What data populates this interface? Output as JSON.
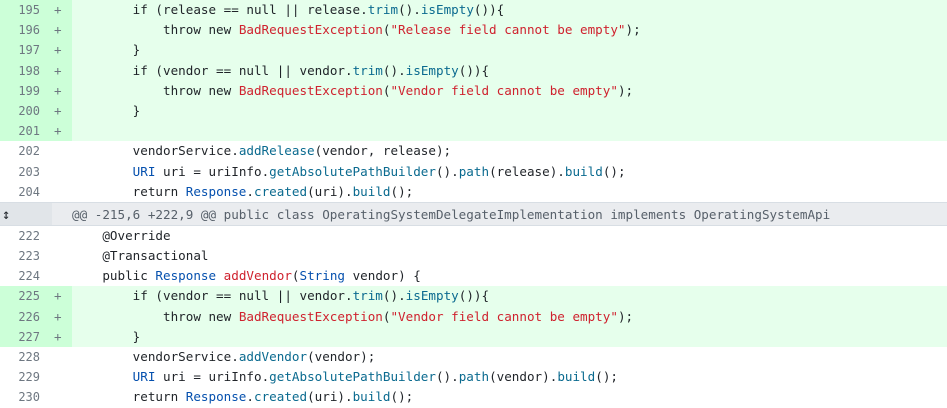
{
  "diff": {
    "marker_added": "+",
    "hunk_header": "@@ -215,6 +222,9 @@ public class OperatingSystemDelegateImplementation implements OperatingSystemApi",
    "expand_icon": "↕",
    "rows_top": [
      {
        "num": "195",
        "type": "add",
        "tokens": [
          {
            "t": "        if (release == "
          },
          {
            "t": "null",
            "c": "kw"
          },
          {
            "t": " || release."
          },
          {
            "t": "trim",
            "c": "fn"
          },
          {
            "t": "()."
          },
          {
            "t": "isEmpty",
            "c": "fn"
          },
          {
            "t": "()){"
          }
        ]
      },
      {
        "num": "196",
        "type": "add",
        "tokens": [
          {
            "t": "            throw new "
          },
          {
            "t": "BadRequestException",
            "c": "cls"
          },
          {
            "t": "("
          },
          {
            "t": "\"Release field cannot be empty\"",
            "c": "cls"
          },
          {
            "t": ");"
          }
        ]
      },
      {
        "num": "197",
        "type": "add",
        "tokens": [
          {
            "t": "        }"
          }
        ]
      },
      {
        "num": "198",
        "type": "add",
        "tokens": [
          {
            "t": "        if (vendor == "
          },
          {
            "t": "null",
            "c": "kw"
          },
          {
            "t": " || vendor."
          },
          {
            "t": "trim",
            "c": "fn"
          },
          {
            "t": "()."
          },
          {
            "t": "isEmpty",
            "c": "fn"
          },
          {
            "t": "()){"
          }
        ]
      },
      {
        "num": "199",
        "type": "add",
        "tokens": [
          {
            "t": "            throw new "
          },
          {
            "t": "BadRequestException",
            "c": "cls"
          },
          {
            "t": "("
          },
          {
            "t": "\"Vendor field cannot be empty\"",
            "c": "cls"
          },
          {
            "t": ");"
          }
        ]
      },
      {
        "num": "200",
        "type": "add",
        "tokens": [
          {
            "t": "        }"
          }
        ]
      },
      {
        "num": "201",
        "type": "add",
        "tokens": [
          {
            "t": ""
          }
        ]
      },
      {
        "num": "202",
        "type": "ctx",
        "tokens": [
          {
            "t": "        vendorService."
          },
          {
            "t": "addRelease",
            "c": "fn"
          },
          {
            "t": "(vendor, release);"
          }
        ]
      },
      {
        "num": "203",
        "type": "ctx",
        "tokens": [
          {
            "t": "        "
          },
          {
            "t": "URI",
            "c": "tp"
          },
          {
            "t": " uri = uriInfo."
          },
          {
            "t": "getAbsolutePathBuilder",
            "c": "fn"
          },
          {
            "t": "()."
          },
          {
            "t": "path",
            "c": "fn"
          },
          {
            "t": "(release)."
          },
          {
            "t": "build",
            "c": "fn"
          },
          {
            "t": "();"
          }
        ]
      },
      {
        "num": "204",
        "type": "ctx",
        "tokens": [
          {
            "t": "        return "
          },
          {
            "t": "Response",
            "c": "tp"
          },
          {
            "t": "."
          },
          {
            "t": "created",
            "c": "fn"
          },
          {
            "t": "(uri)."
          },
          {
            "t": "build",
            "c": "fn"
          },
          {
            "t": "();"
          }
        ]
      }
    ],
    "rows_bottom": [
      {
        "num": "222",
        "type": "ctx",
        "tokens": [
          {
            "t": "    @Override"
          }
        ]
      },
      {
        "num": "223",
        "type": "ctx",
        "tokens": [
          {
            "t": "    @Transactional"
          }
        ]
      },
      {
        "num": "224",
        "type": "ctx",
        "tokens": [
          {
            "t": "    public "
          },
          {
            "t": "Response",
            "c": "tp"
          },
          {
            "t": " "
          },
          {
            "t": "addVendor",
            "c": "cls"
          },
          {
            "t": "("
          },
          {
            "t": "String",
            "c": "tp"
          },
          {
            "t": " vendor) {"
          }
        ]
      },
      {
        "num": "225",
        "type": "add",
        "tokens": [
          {
            "t": "        if (vendor == "
          },
          {
            "t": "null",
            "c": "kw"
          },
          {
            "t": " || vendor."
          },
          {
            "t": "trim",
            "c": "fn"
          },
          {
            "t": "()."
          },
          {
            "t": "isEmpty",
            "c": "fn"
          },
          {
            "t": "()){"
          }
        ]
      },
      {
        "num": "226",
        "type": "add",
        "tokens": [
          {
            "t": "            throw new "
          },
          {
            "t": "BadRequestException",
            "c": "cls"
          },
          {
            "t": "("
          },
          {
            "t": "\"Vendor field cannot be empty\"",
            "c": "cls"
          },
          {
            "t": ");"
          }
        ]
      },
      {
        "num": "227",
        "type": "add",
        "tokens": [
          {
            "t": "        }"
          }
        ]
      },
      {
        "num": "228",
        "type": "ctx",
        "tokens": [
          {
            "t": "        vendorService."
          },
          {
            "t": "addVendor",
            "c": "fn"
          },
          {
            "t": "(vendor);"
          }
        ]
      },
      {
        "num": "229",
        "type": "ctx",
        "tokens": [
          {
            "t": "        "
          },
          {
            "t": "URI",
            "c": "tp"
          },
          {
            "t": " uri = uriInfo."
          },
          {
            "t": "getAbsolutePathBuilder",
            "c": "fn"
          },
          {
            "t": "()."
          },
          {
            "t": "path",
            "c": "fn"
          },
          {
            "t": "(vendor)."
          },
          {
            "t": "build",
            "c": "fn"
          },
          {
            "t": "();"
          }
        ]
      },
      {
        "num": "230",
        "type": "ctx",
        "tokens": [
          {
            "t": "        return "
          },
          {
            "t": "Response",
            "c": "tp"
          },
          {
            "t": "."
          },
          {
            "t": "created",
            "c": "fn"
          },
          {
            "t": "(uri)."
          },
          {
            "t": "build",
            "c": "fn"
          },
          {
            "t": "();"
          }
        ]
      }
    ]
  }
}
